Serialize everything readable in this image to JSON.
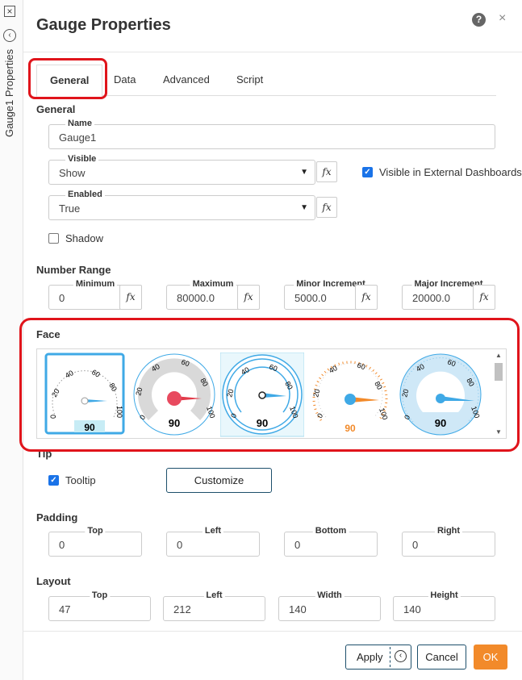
{
  "sidebar": {
    "label": "Gauge1 Properties"
  },
  "dialog": {
    "title": "Gauge Properties",
    "help_glyph": "?",
    "close_glyph": "×"
  },
  "tabs": [
    {
      "label": "General",
      "active": true
    },
    {
      "label": "Data",
      "active": false
    },
    {
      "label": "Advanced",
      "active": false
    },
    {
      "label": "Script",
      "active": false
    }
  ],
  "general": {
    "title": "General",
    "name_label": "Name",
    "name_value": "Gauge1",
    "visible_label": "Visible",
    "visible_value": "Show",
    "visible_external_label": "Visible in External Dashboards",
    "visible_external_checked": true,
    "enabled_label": "Enabled",
    "enabled_value": "True",
    "shadow_label": "Shadow",
    "shadow_checked": false
  },
  "number_range": {
    "title": "Number Range",
    "minimum_label": "Minimum",
    "minimum_value": "0",
    "maximum_label": "Maximum",
    "maximum_value": "80000.0",
    "minor_label": "Minor Increment",
    "minor_value": "5000.0",
    "major_label": "Major Increment",
    "major_value": "20000.0"
  },
  "face": {
    "title": "Face",
    "gauges": [
      {
        "value": "90",
        "ticks": [
          "0",
          "20",
          "40",
          "60",
          "80",
          "100"
        ],
        "selected": false,
        "style": "rect"
      },
      {
        "value": "90",
        "ticks": [
          "0",
          "20",
          "40",
          "60",
          "80",
          "100"
        ],
        "selected": false,
        "style": "grey"
      },
      {
        "value": "90",
        "ticks": [
          "0",
          "20",
          "40",
          "60",
          "80",
          "100"
        ],
        "selected": true,
        "style": "ring"
      },
      {
        "value": "90",
        "ticks": [
          "0",
          "20",
          "40",
          "60",
          "80",
          "100"
        ],
        "selected": false,
        "style": "orange"
      },
      {
        "value": "90",
        "ticks": [
          "0",
          "20",
          "40",
          "60",
          "80",
          "100"
        ],
        "selected": false,
        "style": "lightblue"
      }
    ]
  },
  "tip": {
    "title": "Tip",
    "tooltip_label": "Tooltip",
    "tooltip_checked": true,
    "customize_label": "Customize"
  },
  "padding": {
    "title": "Padding",
    "top_label": "Top",
    "top_value": "0",
    "left_label": "Left",
    "left_value": "0",
    "bottom_label": "Bottom",
    "bottom_value": "0",
    "right_label": "Right",
    "right_value": "0"
  },
  "layout": {
    "title": "Layout",
    "top_label": "Top",
    "top_value": "47",
    "left_label": "Left",
    "left_value": "212",
    "width_label": "Width",
    "width_value": "140",
    "height_label": "Height",
    "height_value": "140"
  },
  "footer": {
    "apply_label": "Apply",
    "cancel_label": "Cancel",
    "ok_label": "OK"
  },
  "colors": {
    "accent_orange": "#f28a2a",
    "highlight_red": "#e0141b",
    "checkbox_blue": "#1a73e8",
    "gauge_blue": "#3fa9e6"
  },
  "fx_glyph": "fx"
}
